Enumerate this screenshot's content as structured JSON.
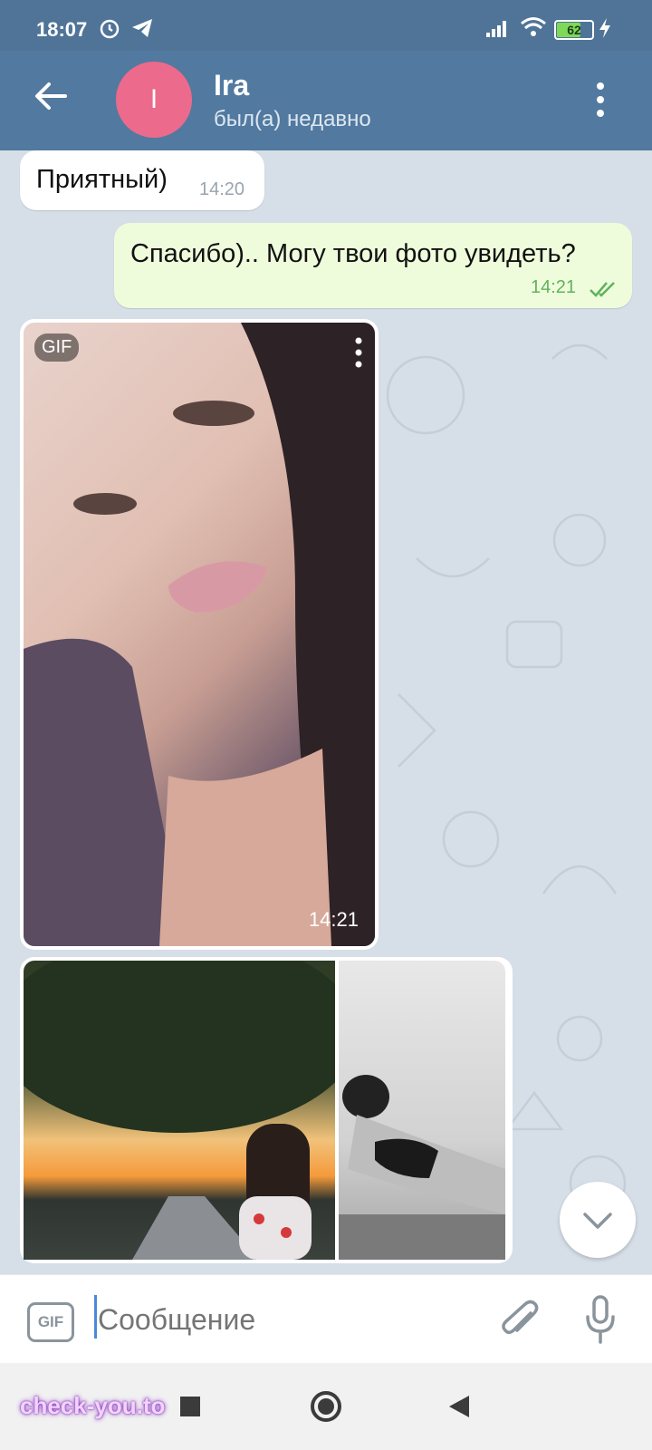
{
  "status_bar": {
    "time": "18:07",
    "battery": "62"
  },
  "header": {
    "avatar_letter": "I",
    "title": "Ira",
    "subtitle": "был(а) недавно"
  },
  "messages": [
    {
      "text": "Приятный)",
      "time": "14:20"
    },
    {
      "text": "Спасибо).. Могу твои фото увидеть?",
      "time": "14:21"
    }
  ],
  "media": {
    "gif_badge": "GIF",
    "time": "14:21"
  },
  "input": {
    "gif_button": "GIF",
    "placeholder": "Сообщение"
  },
  "watermark": "check-you.to",
  "colors": {
    "header": "#52799f",
    "outgoing_bubble": "#effcdc",
    "read_checks": "#5fb35b",
    "avatar": "#ec6a8b"
  }
}
